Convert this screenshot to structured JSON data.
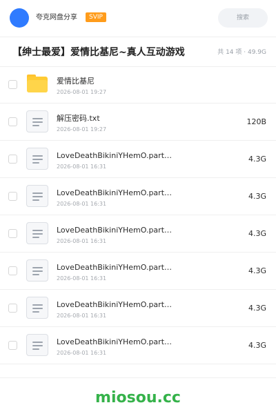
{
  "header": {
    "user_name": "夸克网盘分享",
    "badge": "SVIP",
    "search_placeholder": "搜索"
  },
  "share": {
    "title": "【绅士最爱】爱情比基尼~真人互动游戏",
    "meta": "共 14 项 · 49.9G"
  },
  "files": [
    {
      "type": "folder",
      "icon": "folder-icon",
      "name": "爱情比基尼",
      "date": "2026-08-01 19:27",
      "size": ""
    },
    {
      "type": "doc",
      "icon": "text-file-icon",
      "name": "解压密码.txt",
      "date": "2026-08-01 19:27",
      "size": "120B"
    },
    {
      "type": "doc",
      "icon": "archive-part-icon",
      "name": "LoveDeathBikiniYHemO.part…",
      "date": "2026-08-01 16:31",
      "size": "4.3G"
    },
    {
      "type": "doc",
      "icon": "archive-part-icon",
      "name": "LoveDeathBikiniYHemO.part…",
      "date": "2026-08-01 16:31",
      "size": "4.3G"
    },
    {
      "type": "doc",
      "icon": "archive-part-icon",
      "name": "LoveDeathBikiniYHemO.part…",
      "date": "2026-08-01 16:31",
      "size": "4.3G"
    },
    {
      "type": "doc",
      "icon": "archive-part-icon",
      "name": "LoveDeathBikiniYHemO.part…",
      "date": "2026-08-01 16:31",
      "size": "4.3G"
    },
    {
      "type": "doc",
      "icon": "archive-part-icon",
      "name": "LoveDeathBikiniYHemO.part…",
      "date": "2026-08-01 16:31",
      "size": "4.3G"
    },
    {
      "type": "doc",
      "icon": "archive-part-icon",
      "name": "LoveDeathBikiniYHemO.part…",
      "date": "2026-08-01 16:31",
      "size": "4.3G"
    }
  ],
  "footer": {
    "watermark": "miosou.cc"
  },
  "colors": {
    "avatar": "#2f7bff",
    "badge": "#ff9c1b",
    "folder": "#ffcb33",
    "watermark": "#35b24a"
  }
}
